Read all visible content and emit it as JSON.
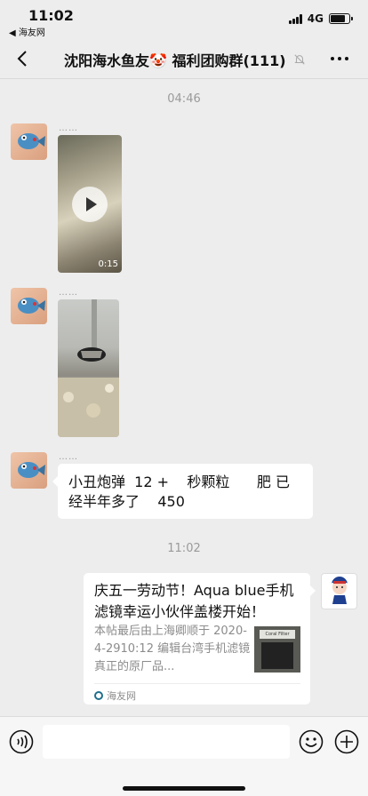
{
  "status_bar": {
    "time": "11:02",
    "back_app": "◀ 海友网",
    "network": "4G",
    "battery_level": 0.8
  },
  "nav": {
    "title": "沈阳海水鱼友🤡 福利团购群(111)",
    "back_icon": "chevron-left-icon",
    "mute_icon": "bell-off-icon",
    "more_icon": "more-icon"
  },
  "chat": {
    "timestamp_1": "04:46",
    "timestamp_2": "11:02",
    "messages": [
      {
        "type": "video",
        "sender": "……",
        "duration": "0:15"
      },
      {
        "type": "image",
        "sender": "……"
      },
      {
        "type": "text",
        "sender": "……",
        "text": "小丑炮弹  12 +    秒颗粒      肥 已经半年多了    450"
      },
      {
        "type": "link",
        "title": "庆五一劳动节！Aqua blue手机滤镜幸运小伙伴盖楼开始！",
        "description": "本帖最后由上海卿顺于 2020-4-2910:12 编辑台湾手机滤镜真正的原厂品...",
        "thumb_label": "Coral Filter",
        "source": "海友网"
      }
    ]
  },
  "input_bar": {
    "placeholder": "",
    "voice_icon": "voice-icon",
    "emoji_icon": "emoji-icon",
    "plus_icon": "plus-circle-icon"
  }
}
